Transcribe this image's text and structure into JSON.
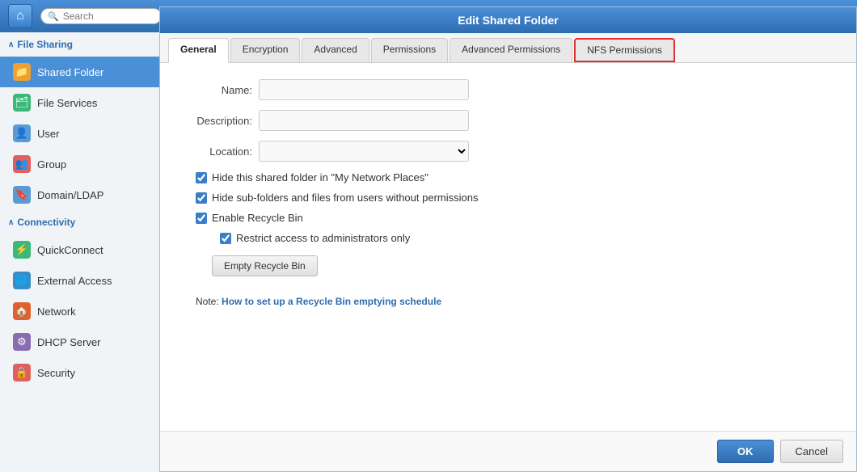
{
  "topbar": {
    "home_icon": "⌂",
    "search_placeholder": "Search"
  },
  "sidebar": {
    "file_sharing_section": "File Sharing",
    "connectivity_section": "Connectivity",
    "items": [
      {
        "id": "shared-folder",
        "label": "Shared Folder",
        "icon": "📁",
        "iconClass": "icon-shared-folder",
        "active": true
      },
      {
        "id": "file-services",
        "label": "File Services",
        "icon": "🗂",
        "iconClass": "icon-file-services",
        "active": false
      },
      {
        "id": "user",
        "label": "User",
        "icon": "👤",
        "iconClass": "icon-user",
        "active": false
      },
      {
        "id": "group",
        "label": "Group",
        "icon": "👥",
        "iconClass": "icon-group",
        "active": false
      },
      {
        "id": "domain-ldap",
        "label": "Domain/LDAP",
        "icon": "🔖",
        "iconClass": "icon-domain",
        "active": false
      }
    ],
    "connectivity_items": [
      {
        "id": "quickconnect",
        "label": "QuickConnect",
        "icon": "⚡",
        "iconClass": "icon-quickconnect",
        "active": false
      },
      {
        "id": "external-access",
        "label": "External Access",
        "icon": "🌐",
        "iconClass": "icon-external",
        "active": false
      },
      {
        "id": "network",
        "label": "Network",
        "icon": "🏠",
        "iconClass": "icon-network",
        "active": false
      },
      {
        "id": "dhcp-server",
        "label": "DHCP Server",
        "icon": "⚙",
        "iconClass": "icon-dhcp",
        "active": false
      },
      {
        "id": "security",
        "label": "Security",
        "icon": "🔒",
        "iconClass": "icon-security",
        "active": false
      }
    ]
  },
  "dialog": {
    "title": "Edit Shared Folder",
    "tabs": [
      {
        "id": "general",
        "label": "General",
        "active": true,
        "highlighted": false
      },
      {
        "id": "encryption",
        "label": "Encryption",
        "active": false,
        "highlighted": false
      },
      {
        "id": "advanced",
        "label": "Advanced",
        "active": false,
        "highlighted": false
      },
      {
        "id": "permissions",
        "label": "Permissions",
        "active": false,
        "highlighted": false
      },
      {
        "id": "advanced-permissions",
        "label": "Advanced Permissions",
        "active": false,
        "highlighted": false
      },
      {
        "id": "nfs-permissions",
        "label": "NFS Permissions",
        "active": false,
        "highlighted": true
      }
    ],
    "form": {
      "name_label": "Name:",
      "name_value": "",
      "description_label": "Description:",
      "description_value": "",
      "location_label": "Location:",
      "location_value": "",
      "checkbox1_label": "Hide this shared folder in \"My Network Places\"",
      "checkbox1_checked": true,
      "checkbox2_label": "Hide sub-folders and files from users without permissions",
      "checkbox2_checked": true,
      "checkbox3_label": "Enable Recycle Bin",
      "checkbox3_checked": true,
      "checkbox4_label": "Restrict access to administrators only",
      "checkbox4_checked": true,
      "empty_recycle_btn": "Empty Recycle Bin",
      "note_prefix": "Note:",
      "note_link": "How to set up a Recycle Bin emptying schedule"
    },
    "footer": {
      "ok_label": "OK",
      "cancel_label": "Cancel"
    }
  }
}
